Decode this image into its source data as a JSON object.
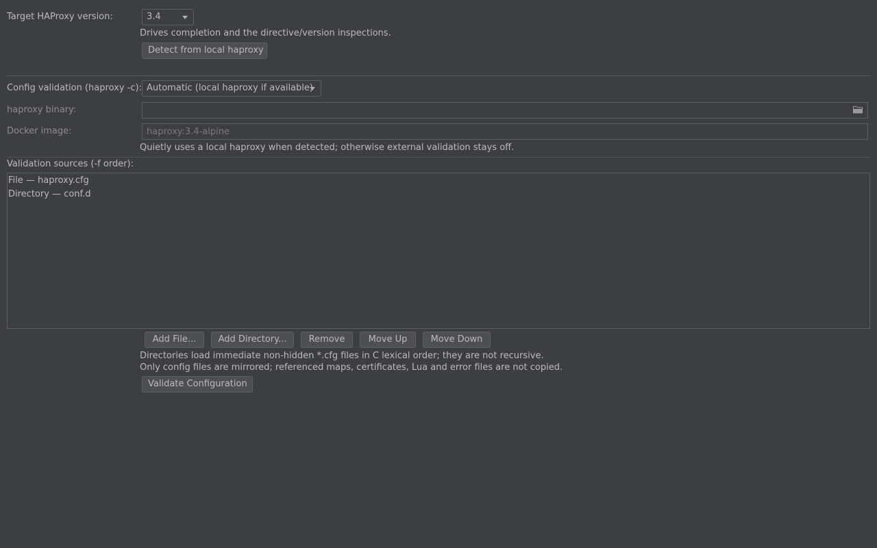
{
  "target_version": {
    "label": "Target HAProxy version:",
    "selected": "3.4",
    "hint": "Drives completion and the directive/version inspections.",
    "detect_button": "Detect from local haproxy"
  },
  "validation": {
    "label": "Config validation (haproxy -c):",
    "selected": "Automatic (local haproxy if available)",
    "binary_label": "haproxy binary:",
    "binary_value": "",
    "docker_label": "Docker image:",
    "docker_placeholder": "haproxy:3.4-alpine",
    "hint": "Quietly uses a local haproxy when detected; otherwise external validation stays off."
  },
  "sources": {
    "label": "Validation sources (-f order):",
    "items": [
      "File — haproxy.cfg",
      "Directory — conf.d"
    ],
    "buttons": {
      "add_file": "Add File...",
      "add_directory": "Add Directory...",
      "remove": "Remove",
      "move_up": "Move Up",
      "move_down": "Move Down"
    },
    "note1": "Directories load immediate non-hidden *.cfg files in C lexical order; they are not recursive.",
    "note2": "Only config files are mirrored; referenced maps, certificates, Lua and error files are not copied.",
    "validate_button": "Validate Configuration"
  },
  "icons": {
    "binary_browse": "folder-icon",
    "combo_arrow": "chevron-down-icon"
  }
}
